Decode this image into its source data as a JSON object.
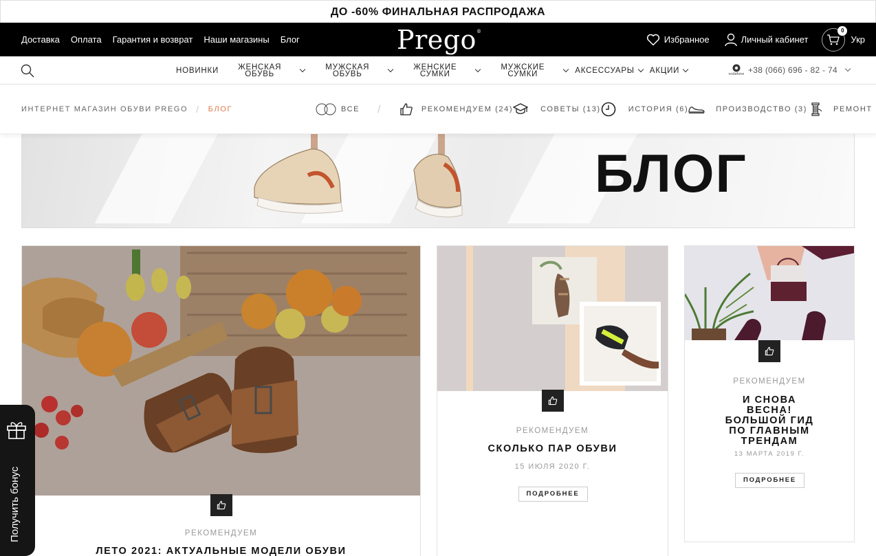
{
  "promo": "ДО -60% ФИНАЛЬНАЯ РАСПРОДАЖА",
  "topbar": {
    "links": [
      "Доставка",
      "Оплата",
      "Гарантия и возврат",
      "Наши магазины",
      "Блог"
    ],
    "logo": "Prego",
    "favorites": "Избранное",
    "account": "Личный кабинет",
    "cart_count": "0",
    "language": "Укр"
  },
  "nav": {
    "new": "НОВИНКИ",
    "women_shoes_1": "ЖЕНСКАЯ",
    "women_shoes_2": "ОБУВЬ",
    "men_shoes_1": "МУЖСКАЯ",
    "men_shoes_2": "ОБУВЬ",
    "women_bags_1": "ЖЕНСКИЕ",
    "women_bags_2": "СУМКИ",
    "men_bags_1": "МУЖСКИЕ",
    "men_bags_2": "СУМКИ",
    "accessories": "АКСЕССУАРЫ",
    "sales": "АКЦИИ",
    "operator": "vodafone",
    "phone": "+38 (066) 696 - 82 - 74"
  },
  "breadcrumb": {
    "home": "ИНТЕРНЕТ МАГАЗИН ОБУВИ PREGO",
    "sep": "/",
    "current": "БЛОГ"
  },
  "filters": {
    "all": "ВСЕ",
    "sep": "/",
    "recommended": "РЕКОМЕНДУЕМ (24)",
    "tips": "СОВЕТЫ (13)",
    "history": "ИСТОРИЯ (6)",
    "production": "ПРОИЗВОДСТВО (3)",
    "repair": "РЕМОНТ"
  },
  "hero": {
    "title": "БЛОГ"
  },
  "posts": [
    {
      "category": "РЕКОМЕНДУЕМ",
      "title": "ЛЕТО 2021: АКТУАЛЬНЫЕ МОДЕЛИ ОБУВИ"
    },
    {
      "category": "РЕКОМЕНДУЕМ",
      "title": "СКОЛЬКО ПАР ОБУВИ",
      "date": "15 ИЮЛЯ 2020 Г.",
      "more": "ПОДРОБНЕЕ"
    },
    {
      "category": "РЕКОМЕНДУЕМ",
      "title_lines": [
        "И СНОВА",
        "ВЕСНА!",
        "БОЛЬШОЙ ГИД",
        "ПО ГЛАВНЫМ",
        "ТРЕНДАМ"
      ],
      "date": "13 МАРТА 2019 Г.",
      "more": "ПОДРОБНЕЕ"
    }
  ],
  "bonus": "Получить бонус",
  "icons": {
    "search": "search-icon",
    "heart": "heart-icon",
    "user": "user-icon",
    "cart": "cart-icon",
    "like": "thumbs-up-icon",
    "gift": "gift-icon",
    "graduation": "graduation-cap-icon",
    "clock": "clock-icon",
    "shoe": "shoe-icon",
    "thread": "thread-spool-icon"
  },
  "colors": {
    "accent": "#e07a4d",
    "dark": "#000000"
  }
}
